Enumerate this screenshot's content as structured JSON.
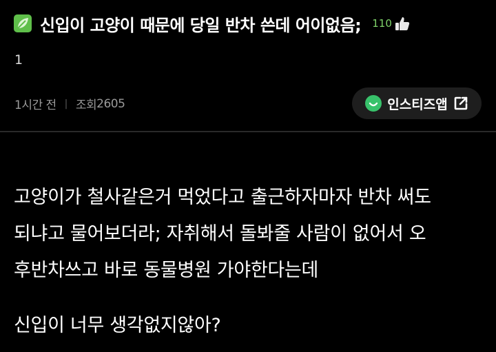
{
  "post": {
    "title": "신입이 고양이 때문에 당일 반차 쓴데 어이없음;",
    "like_count": "110",
    "comment_count": "1",
    "time_ago": "1시간 전",
    "views_label": "조회",
    "views_count": "2605",
    "app_button_label": "인스티즈앱",
    "body_lines": [
      "고양이가 철사같은거 먹었다고 출근하자마자 반차 써도",
      "되냐고 물어보더라; 자취해서 돌봐줄 사람이 없어서 오",
      "후반차쓰고 바로 동물병원 가야한다는데"
    ],
    "question": "신입이 너무 생각없지않아?"
  },
  "colors": {
    "background": "#000000",
    "accent_green": "#7fd36a",
    "leaf_green": "#5fbf4a",
    "app_smile_green": "#38c26b",
    "meta_gray": "#9a9a9a",
    "button_bg": "#1e1e1e"
  },
  "icons": {
    "category": "leaf-icon",
    "like": "thumbs-up-icon",
    "app": "smile-icon",
    "external": "external-link-icon"
  }
}
